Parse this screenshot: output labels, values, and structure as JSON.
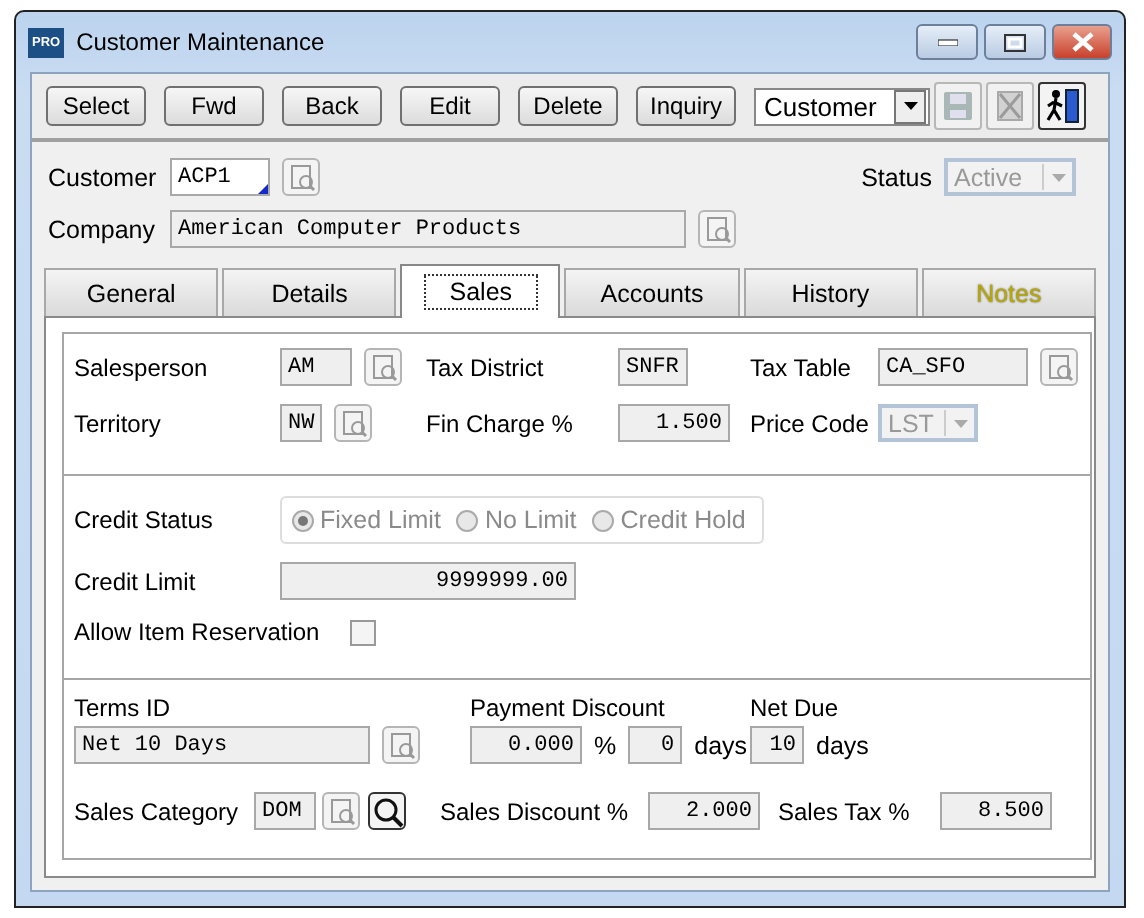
{
  "window": {
    "title": "Customer Maintenance",
    "app_badge": "PRO"
  },
  "toolbar": {
    "buttons": [
      {
        "label": "Select"
      },
      {
        "label": "Fwd"
      },
      {
        "label": "Back"
      },
      {
        "label": "Edit"
      },
      {
        "label": "Delete"
      },
      {
        "label": "Inquiry"
      }
    ],
    "mode_dropdown": {
      "value": "Customer"
    }
  },
  "header": {
    "customer": {
      "label": "Customer",
      "value": "ACP1"
    },
    "company": {
      "label": "Company",
      "value": "American Computer Products"
    },
    "status": {
      "label": "Status",
      "value": "Active",
      "disabled": true
    }
  },
  "tabs": [
    {
      "label": "General",
      "selected": false,
      "highlighted": false
    },
    {
      "label": "Details",
      "selected": false,
      "highlighted": false
    },
    {
      "label": "Sales",
      "selected": true,
      "highlighted": false
    },
    {
      "label": "Accounts",
      "selected": false,
      "highlighted": false
    },
    {
      "label": "History",
      "selected": false,
      "highlighted": false
    },
    {
      "label": "Notes",
      "selected": false,
      "highlighted": true
    }
  ],
  "sales": {
    "salesperson": {
      "label": "Salesperson",
      "value": "AM"
    },
    "tax_district": {
      "label": "Tax District",
      "value": "SNFR"
    },
    "tax_table": {
      "label": "Tax Table",
      "value": "CA_SFO"
    },
    "territory": {
      "label": "Territory",
      "value": "NW"
    },
    "fin_charge": {
      "label": "Fin Charge %",
      "value": "1.500"
    },
    "price_code": {
      "label": "Price Code",
      "value": "LST",
      "disabled": true
    },
    "credit_status": {
      "label": "Credit Status",
      "disabled": true,
      "options": [
        {
          "label": "Fixed Limit",
          "selected": true
        },
        {
          "label": "No Limit",
          "selected": false
        },
        {
          "label": "Credit Hold",
          "selected": false
        }
      ]
    },
    "credit_limit": {
      "label": "Credit Limit",
      "value": "9999999.00"
    },
    "allow_item_reservation": {
      "label": "Allow Item Reservation",
      "checked": false
    },
    "terms_id": {
      "label": "Terms ID",
      "value": "Net 10 Days"
    },
    "payment_discount": {
      "label": "Payment Discount",
      "value": "0.000",
      "unit": "%",
      "days": "0",
      "days_unit": "days"
    },
    "net_due": {
      "label": "Net Due",
      "value": "10",
      "unit": "days"
    },
    "sales_category": {
      "label": "Sales Category",
      "value": "DOM"
    },
    "sales_discount": {
      "label": "Sales Discount %",
      "value": "2.000"
    },
    "sales_tax": {
      "label": "Sales Tax %",
      "value": "8.500"
    }
  }
}
